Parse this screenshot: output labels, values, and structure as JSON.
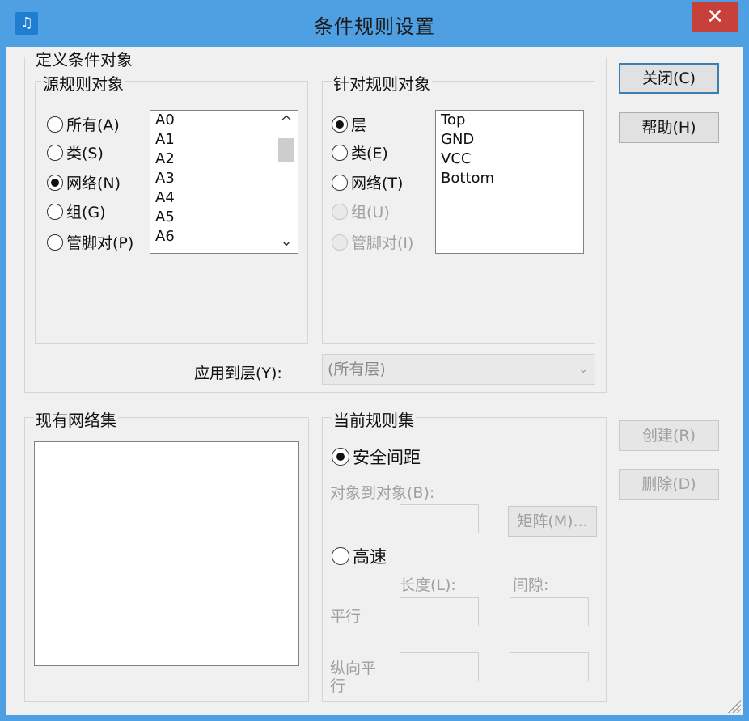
{
  "window": {
    "title": "条件规则设置",
    "close_symbol": "✕",
    "app_icon": "music-note-icon"
  },
  "define_group": {
    "label": "定义条件对象"
  },
  "source_group": {
    "label": "源规则对象",
    "radios": [
      {
        "label": "所有(A)",
        "checked": false
      },
      {
        "label": "类(S)",
        "checked": false
      },
      {
        "label": "网络(N)",
        "checked": true
      },
      {
        "label": "组(G)",
        "checked": false
      },
      {
        "label": "管脚对(P)",
        "checked": false
      }
    ],
    "list_items": [
      "A0",
      "A1",
      "A2",
      "A3",
      "A4",
      "A5",
      "A6"
    ],
    "scroll_up": "^",
    "scroll_down": "⌄"
  },
  "target_group": {
    "label": "针对规则对象",
    "radios": [
      {
        "label": "层",
        "checked": true,
        "disabled": false
      },
      {
        "label": "类(E)",
        "checked": false,
        "disabled": false
      },
      {
        "label": "网络(T)",
        "checked": false,
        "disabled": false
      },
      {
        "label": "组(U)",
        "checked": false,
        "disabled": true
      },
      {
        "label": "管脚对(I)",
        "checked": false,
        "disabled": true
      }
    ],
    "list_items": [
      "Top",
      "GND",
      "VCC",
      "Bottom"
    ]
  },
  "apply_layer": {
    "label": "应用到层(Y):",
    "value": "(所有层)",
    "arrow": "⌄"
  },
  "buttons": {
    "close": "关闭(C)",
    "help": "帮助(H)",
    "create": "创建(R)",
    "delete": "删除(D)",
    "matrix": "矩阵(M)..."
  },
  "existing_nets": {
    "label": "现有网络集"
  },
  "current_rules": {
    "label": "当前规则集",
    "clearance_radio": "安全间距",
    "obj_to_obj": "对象到对象(B):",
    "high_speed_radio": "高速",
    "length_label": "长度(L):",
    "gap_label": "间隙:",
    "parallel_label": "平行",
    "tandem_label_1": "纵向平",
    "tandem_label_2": "行"
  }
}
